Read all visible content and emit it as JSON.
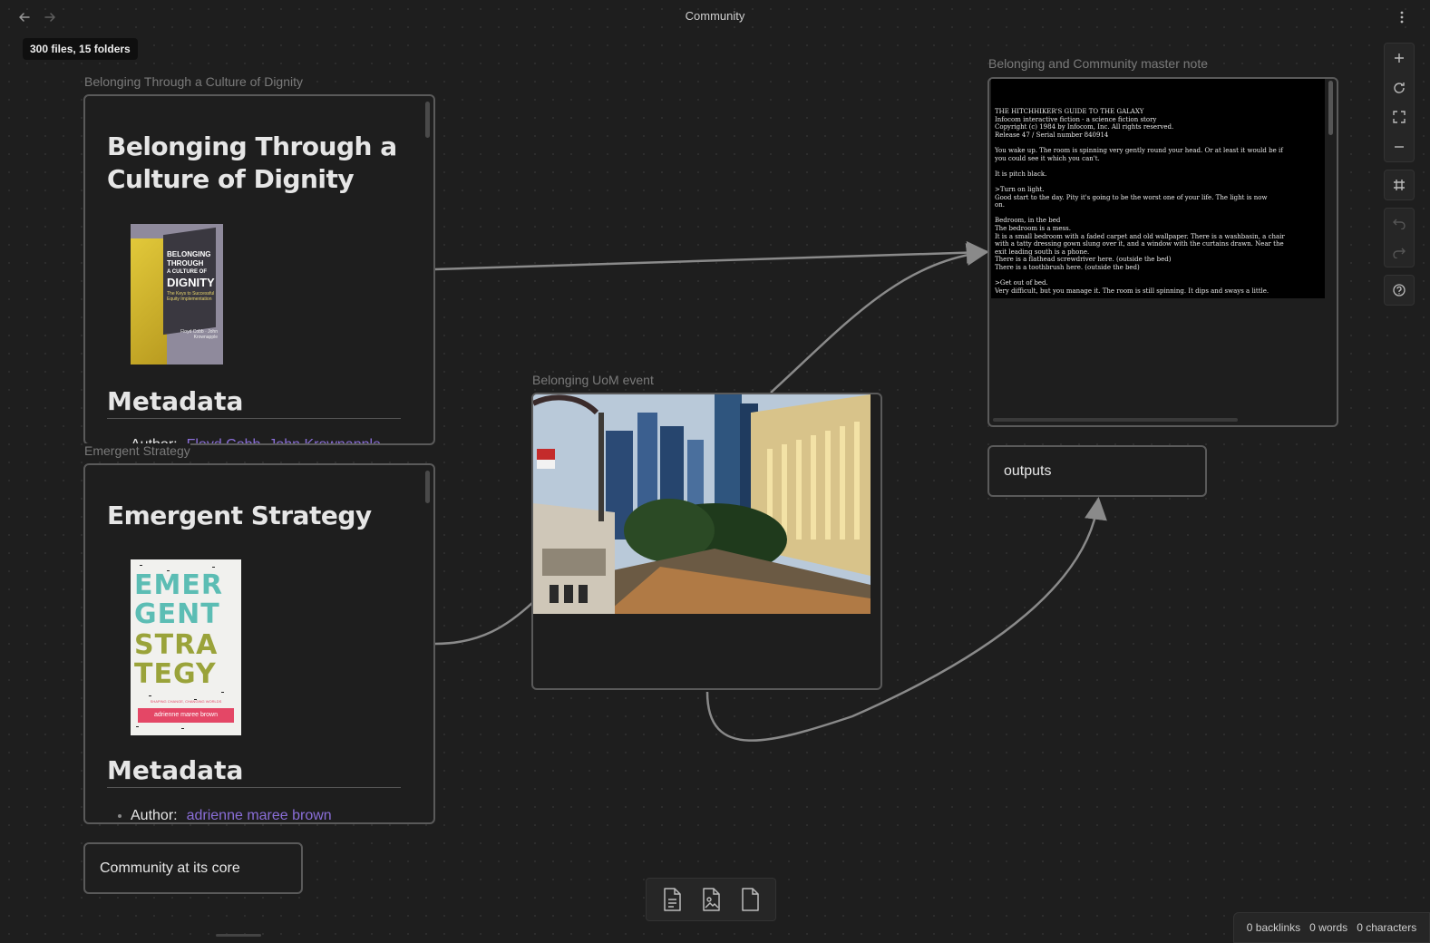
{
  "window": {
    "title": "Community"
  },
  "tooltip": "300 files, 15 folders",
  "nodes": {
    "dignity": {
      "label": "Belonging Through a Culture of Dignity",
      "heading": "Belonging Through a Culture of Dignity",
      "cover": {
        "line1": "BELONGING",
        "line2": "THROUGH",
        "line3": "A CULTURE OF",
        "line4": "DIGNITY",
        "subtitle": "The Keys to Successful Equity Implementation",
        "authors": "Floyd Cobb · John Krownapple"
      },
      "metadata_heading": "Metadata",
      "metadata_author_label": "Author:",
      "metadata_author_value": "Floyd Cobb, John Krownapple"
    },
    "emergent": {
      "label": "Emergent Strategy",
      "heading": "Emergent Strategy",
      "cover": {
        "line1": "EMER",
        "line2": "GENT",
        "line3": "STRA",
        "line4": "TEGY",
        "tagline": "SHAPING CHANGE, CHANGING WORLDS",
        "author": "adrienne maree brown"
      },
      "metadata_heading": "Metadata",
      "metadata_author_label": "Author:",
      "metadata_author_value": "adrienne maree brown"
    },
    "uom": {
      "label": "Belonging UoM event"
    },
    "master": {
      "label": "Belonging and Community master note",
      "terminal_text": "THE HITCHHIKER'S GUIDE TO THE GALAXY\nInfocom interactive fiction - a science fiction story\nCopyright (c) 1984 by Infocom, Inc. All rights reserved.\nRelease 47 / Serial number 840914\n\nYou wake up. The room is spinning very gently round your head. Or at least it would be if\nyou could see it which you can't.\n\nIt is pitch black.\n\n>Turn on light.\nGood start to the day. Pity it's going to be the worst one of your life. The light is now\non.\n\nBedroom, in the bed\nThe bedroom is a mess.\nIt is a small bedroom with a faded carpet and old wallpaper. There is a washbasin, a chair\nwith a tatty dressing gown slung over it, and a window with the curtains drawn. Near the\nexit leading south is a phone.\nThere is a flathead screwdriver here. (outside the bed)\nThere is a toothbrush here. (outside the bed)\n\n>Get out of bed.\nVery difficult, but you manage it. The room is still spinning. It dips and sways a little."
    },
    "outputs": {
      "text": "outputs"
    },
    "community_core": {
      "text": "Community at its core"
    }
  },
  "status": {
    "backlinks": "0 backlinks",
    "words": "0 words",
    "characters": "0 characters"
  }
}
